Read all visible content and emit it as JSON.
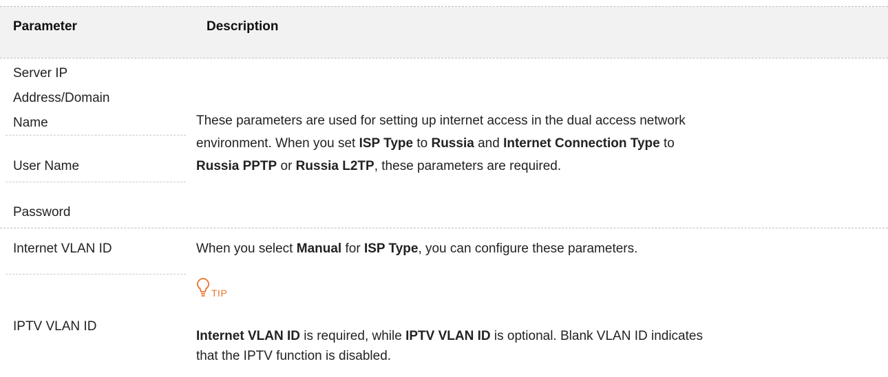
{
  "table": {
    "headers": {
      "parameter": "Parameter",
      "description": "Description"
    },
    "rows": {
      "server_ip": {
        "line1": "Server IP",
        "line2": "Address/Domain",
        "line3": "Name"
      },
      "user_name": "User Name",
      "password": "Password",
      "internet_vlan": "Internet VLAN ID",
      "iptv_vlan": "IPTV VLAN ID"
    },
    "russia_desc": {
      "line1": "These parameters are used for setting up internet access in the dual access network",
      "line2_a": "environment. When you set ",
      "line2_b": "ISP Type",
      "line2_c": " to ",
      "line2_d": "Russia",
      "line2_e": " and ",
      "line2_f": "Internet Connection Type",
      "line2_g": " to",
      "line3_a": "Russia PPTP",
      "line3_b": " or ",
      "line3_c": "Russia L2TP",
      "line3_d": ", these parameters are required."
    },
    "vlan_desc": {
      "a": "When you select ",
      "b": "Manual",
      "c": " for ",
      "d": "ISP Type",
      "e": ", you can configure these parameters."
    },
    "tip": {
      "label": "TIP",
      "line1_a": "Internet VLAN ID",
      "line1_b": " is required, while ",
      "line1_c": "IPTV VLAN ID",
      "line1_d": " is optional. Blank VLAN ID indicates",
      "line2": "that the IPTV function is disabled."
    }
  },
  "colors": {
    "tip_accent": "#e8732f",
    "header_bg": "#f2f2f2",
    "rule": "#bdbdbd"
  },
  "icons": {
    "tip": "lightbulb-icon"
  }
}
